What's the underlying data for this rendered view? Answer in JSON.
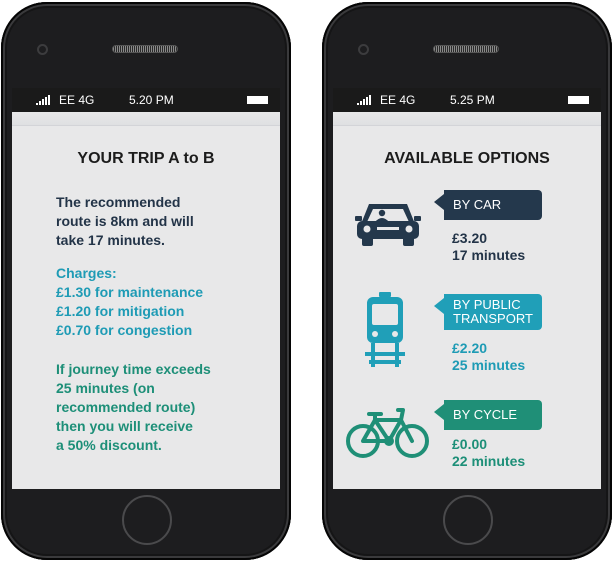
{
  "colors": {
    "dark": "#233448",
    "blue": "#1e9bb5",
    "green": "#1d8f78"
  },
  "left": {
    "status": {
      "carrier": "EE 4G",
      "time": "5.20 PM"
    },
    "title": "YOUR TRIP A to B",
    "intro": [
      "The recommended",
      "route is 8km and will",
      "take 17 minutes."
    ],
    "charges": [
      "Charges:",
      "£1.30 for maintenance",
      "£1.20 for mitigation",
      "£0.70 for congestion"
    ],
    "discount": [
      "If journey time exceeds",
      "25 minutes (on",
      "recommended route)",
      "then you will receive",
      "a 50% discount."
    ]
  },
  "right": {
    "status": {
      "carrier": "EE 4G",
      "time": "5.25 PM"
    },
    "title": "AVAILABLE OPTIONS",
    "options": [
      {
        "label": [
          "BY CAR"
        ],
        "price": "£3.20",
        "time": "17 minutes",
        "icon": "car-icon"
      },
      {
        "label": [
          "BY PUBLIC",
          "TRANSPORT"
        ],
        "price": "£2.20",
        "time": "25 minutes",
        "icon": "train-icon"
      },
      {
        "label": [
          "BY CYCLE"
        ],
        "price": "£0.00",
        "time": "22 minutes",
        "icon": "bicycle-icon"
      }
    ]
  }
}
